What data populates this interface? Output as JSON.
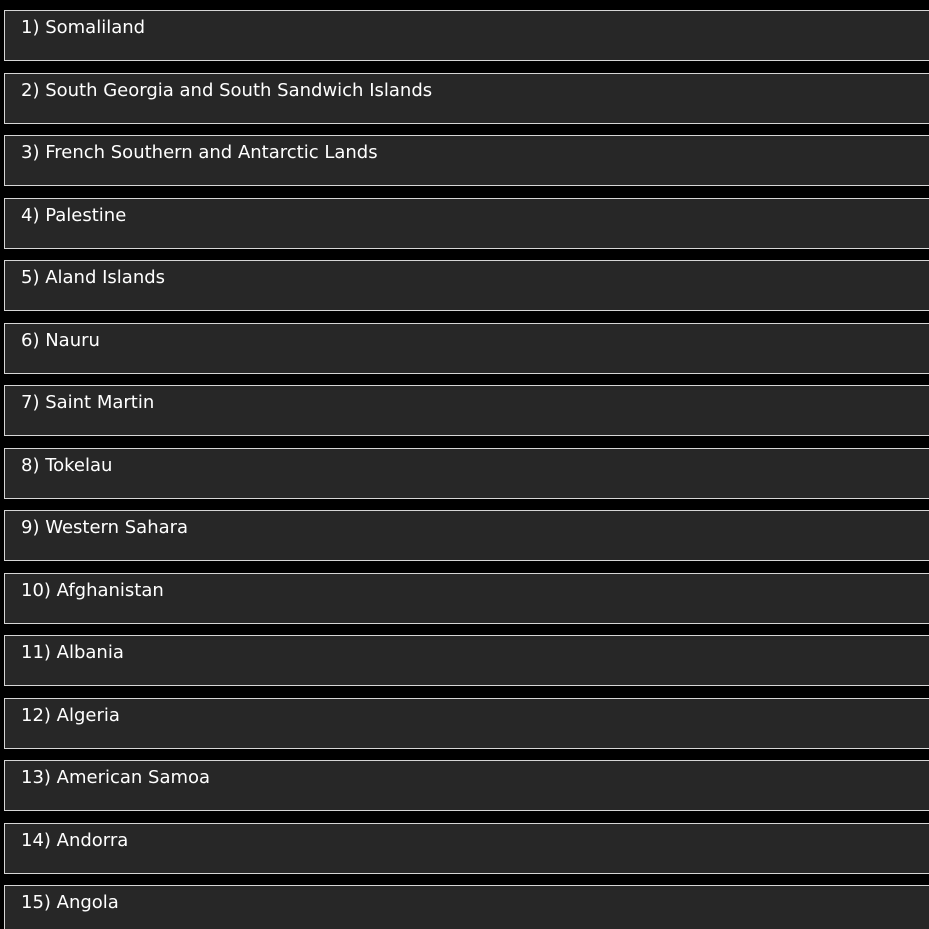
{
  "colors": {
    "background": "#000000",
    "item_background": "#272727",
    "item_border": "#d6d6d6",
    "text": "#ffffff"
  },
  "list": {
    "items": [
      {
        "label": "1) Somaliland"
      },
      {
        "label": "2) South Georgia and South Sandwich Islands"
      },
      {
        "label": "3) French Southern and Antarctic Lands"
      },
      {
        "label": "4) Palestine"
      },
      {
        "label": "5) Aland Islands"
      },
      {
        "label": "6) Nauru"
      },
      {
        "label": "7) Saint Martin"
      },
      {
        "label": "8) Tokelau"
      },
      {
        "label": "9) Western Sahara"
      },
      {
        "label": "10) Afghanistan"
      },
      {
        "label": "11) Albania"
      },
      {
        "label": "12) Algeria"
      },
      {
        "label": "13) American Samoa"
      },
      {
        "label": "14) Andorra"
      },
      {
        "label": "15) Angola"
      }
    ]
  }
}
